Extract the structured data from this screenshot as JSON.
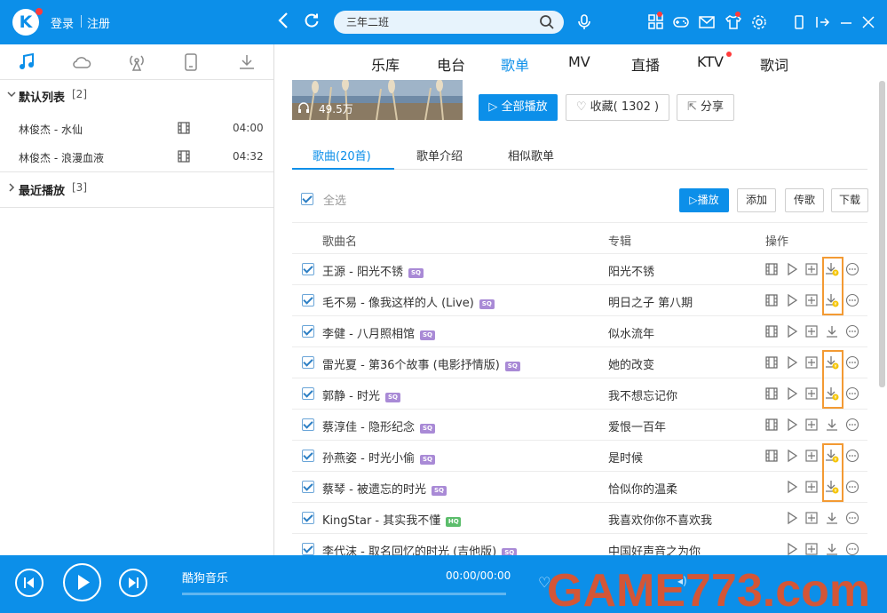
{
  "header": {
    "logo": "K",
    "login": "登录",
    "register": "注册",
    "search_value": "三年二班"
  },
  "sidebar": {
    "groups": [
      {
        "name": "默认列表",
        "count": "[2]",
        "expanded": true
      },
      {
        "name": "最近播放",
        "count": "[3]",
        "expanded": false
      }
    ],
    "songs": [
      {
        "name": "林俊杰 - 水仙",
        "duration": "04:00"
      },
      {
        "name": "林俊杰 - 浪漫血液",
        "duration": "04:32"
      }
    ]
  },
  "nav": {
    "tabs": [
      "乐库",
      "电台",
      "歌单",
      "MV",
      "直播",
      "KTV",
      "歌词"
    ],
    "active": "歌单"
  },
  "playlist": {
    "play_count": "49.5万",
    "play_all": "全部播放",
    "favorite": "收藏( 1302 )",
    "share": "分享"
  },
  "subtabs": [
    "歌曲(20首)",
    "歌单介绍",
    "相似歌单"
  ],
  "toolbar": {
    "select_all": "全选",
    "play": "播放",
    "add": "添加",
    "send": "传歌",
    "download": "下载"
  },
  "columns": {
    "name": "歌曲名",
    "album": "专辑",
    "actions": "操作"
  },
  "songs": [
    {
      "name": "王源 - 阳光不锈",
      "badge": "SQ",
      "album": "阳光不锈",
      "mv": true,
      "vip_download": true
    },
    {
      "name": "毛不易 - 像我这样的人 (Live)",
      "badge": "SQ",
      "album": "明日之子 第八期",
      "mv": true,
      "vip_download": true
    },
    {
      "name": "李健 - 八月照相馆",
      "badge": "SQ",
      "album": "似水流年",
      "mv": true,
      "vip_download": false
    },
    {
      "name": "雷光夏 - 第36个故事 (电影抒情版)",
      "badge": "SQ",
      "album": "她的改变",
      "mv": true,
      "vip_download": true
    },
    {
      "name": "郭静 - 时光",
      "badge": "SQ",
      "album": "我不想忘记你",
      "mv": true,
      "vip_download": true
    },
    {
      "name": "蔡淳佳 - 隐形纪念",
      "badge": "SQ",
      "album": "爱恨一百年",
      "mv": true,
      "vip_download": false
    },
    {
      "name": "孙燕姿 - 时光小偷",
      "badge": "SQ",
      "album": "是时候",
      "mv": true,
      "vip_download": true
    },
    {
      "name": "蔡琴 - 被遗忘的时光",
      "badge": "SQ",
      "album": "恰似你的温柔",
      "mv": false,
      "vip_download": true
    },
    {
      "name": "KingStar - 其实我不懂",
      "badge": "HQ",
      "album": "我喜欢你你不喜欢我",
      "mv": false,
      "vip_download": false
    },
    {
      "name": "李代沫 - 取名回忆的时光 (吉他版)",
      "badge": "SQ",
      "album": "中国好声音之为你",
      "mv": false,
      "vip_download": false
    }
  ],
  "player": {
    "title": "酷狗音乐",
    "time": "00:00/00:00",
    "progress": 0
  },
  "watermark": "GAME773.com",
  "colors": {
    "accent": "#0c8fe9",
    "highlight": "#f39a33"
  }
}
